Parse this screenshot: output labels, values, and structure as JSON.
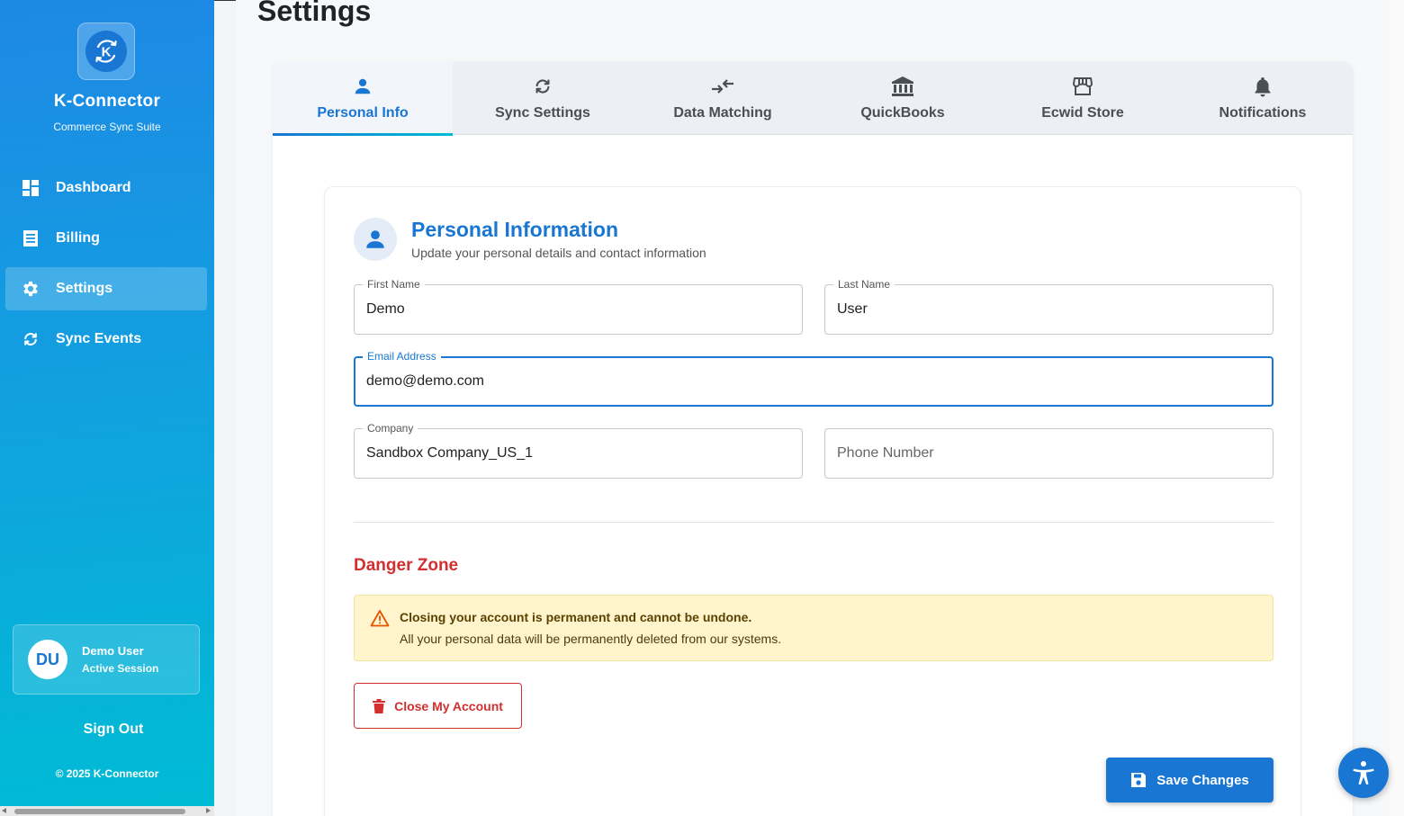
{
  "app": {
    "brand_name": "K-Connector",
    "brand_subtitle": "Commerce Sync Suite",
    "copyright": "© 2025 K-Connector",
    "accent_color": "#1976d2",
    "danger_color": "#d32f2f"
  },
  "sidebar": {
    "items": [
      {
        "label": "Dashboard",
        "icon": "dashboard-icon",
        "active": false
      },
      {
        "label": "Billing",
        "icon": "receipt-icon",
        "active": false
      },
      {
        "label": "Settings",
        "icon": "gear-icon",
        "active": true
      },
      {
        "label": "Sync Events",
        "icon": "sync-icon",
        "active": false
      }
    ],
    "user": {
      "initials": "DU",
      "name": "Demo User",
      "status": "Active Session"
    },
    "sign_out_label": "Sign Out"
  },
  "page": {
    "title": "Settings"
  },
  "tabs": [
    {
      "label": "Personal Info",
      "icon": "person-icon",
      "active": true
    },
    {
      "label": "Sync Settings",
      "icon": "sync-icon",
      "active": false
    },
    {
      "label": "Data Matching",
      "icon": "compare-arrows-icon",
      "active": false
    },
    {
      "label": "QuickBooks",
      "icon": "bank-icon",
      "active": false
    },
    {
      "label": "Ecwid Store",
      "icon": "store-icon",
      "active": false
    },
    {
      "label": "Notifications",
      "icon": "bell-icon",
      "active": false
    }
  ],
  "personal": {
    "section_title": "Personal Information",
    "section_subtitle": "Update your personal details and contact information",
    "first_name": {
      "label": "First Name",
      "value": "Demo"
    },
    "last_name": {
      "label": "Last Name",
      "value": "User"
    },
    "email": {
      "label": "Email Address",
      "value": "demo@demo.com"
    },
    "company": {
      "label": "Company",
      "value": "Sandbox Company_US_1"
    },
    "phone": {
      "placeholder": "Phone Number",
      "value": ""
    }
  },
  "danger": {
    "title": "Danger Zone",
    "warning_strong": "Closing your account is permanent and cannot be undone.",
    "warning_text": "All your personal data will be permanently deleted from our systems.",
    "close_button": "Close My Account"
  },
  "save_button": "Save Changes"
}
